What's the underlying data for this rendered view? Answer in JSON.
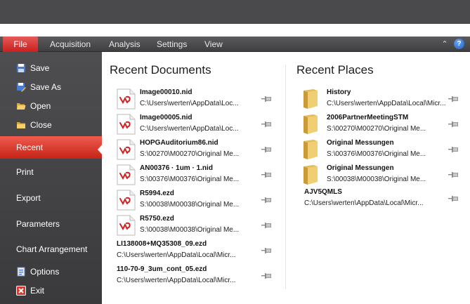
{
  "ribbon": {
    "file_tab": "File",
    "tabs": [
      "Acquisition",
      "Analysis",
      "Settings",
      "View"
    ],
    "help_label": "?"
  },
  "sidebar": {
    "items": [
      {
        "label": "Save",
        "icon": "save-icon"
      },
      {
        "label": "Save As",
        "icon": "save-as-icon"
      },
      {
        "label": "Open",
        "icon": "open-folder-icon"
      },
      {
        "label": "Close",
        "icon": "close-folder-icon"
      },
      {
        "label": "Recent",
        "icon": ""
      },
      {
        "label": "Print",
        "icon": ""
      },
      {
        "label": "Export",
        "icon": ""
      },
      {
        "label": "Parameters",
        "icon": ""
      },
      {
        "label": "Chart Arrangement",
        "icon": ""
      },
      {
        "label": "Options",
        "icon": "options-icon"
      },
      {
        "label": "Exit",
        "icon": "exit-icon"
      }
    ],
    "selected": "Recent"
  },
  "recent_documents": {
    "title": "Recent Documents",
    "items": [
      {
        "name": "Image00010.nid",
        "path": "C:\\Users\\werten\\AppData\\Loc..."
      },
      {
        "name": "Image00005.nid",
        "path": "C:\\Users\\werten\\AppData\\Loc..."
      },
      {
        "name": "HOPGAuditorium86.nid",
        "path": "S:\\00270\\M00270\\Original Me..."
      },
      {
        "name": "AN00376 · 1um · 1.nid",
        "path": "S:\\00376\\M00376\\Original Me..."
      },
      {
        "name": "R5994.ezd",
        "path": "S:\\00038\\M00038\\Original Me..."
      },
      {
        "name": "R5750.ezd",
        "path": "S:\\00038\\M00038\\Original Me..."
      },
      {
        "name": "LI138008+MQ35308_09.ezd",
        "path": "C:\\Users\\werten\\AppData\\Local\\Micr..."
      },
      {
        "name": "110-70-9_3um_cont_05.ezd",
        "path": "C:\\Users\\werten\\AppData\\Local\\Micr..."
      }
    ]
  },
  "recent_places": {
    "title": "Recent Places",
    "items": [
      {
        "name": "History",
        "path": "C:\\Users\\werten\\AppData\\Local\\Micr..."
      },
      {
        "name": "2006PartnerMeetingSTM",
        "path": "S:\\00270\\M00270\\Original Me..."
      },
      {
        "name": "Original Messungen",
        "path": "S:\\00376\\M00376\\Original Me..."
      },
      {
        "name": "Original Messungen",
        "path": "S:\\00038\\M00038\\Original Me..."
      },
      {
        "name": "AJV5QMLS",
        "path": "C:\\Users\\werten\\AppData\\Local\\Micr..."
      }
    ]
  },
  "colors": {
    "accent": "#d7302a",
    "sidebar": "#454548",
    "ribbon": "#505053",
    "folder": "#e9c56a",
    "doc_icon": "#d42020"
  }
}
